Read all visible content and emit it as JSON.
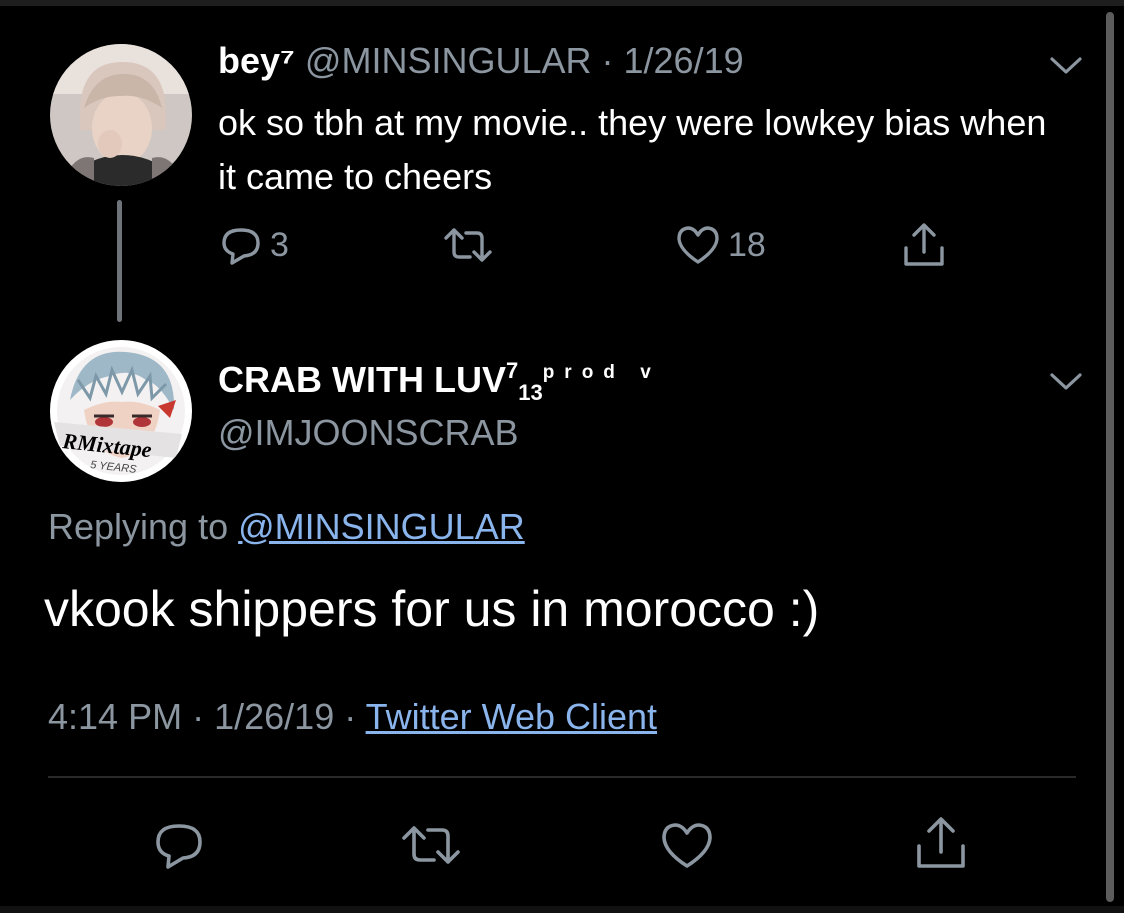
{
  "colors": {
    "background": "#000000",
    "text_primary": "#ffffff",
    "text_secondary": "#8b96a0",
    "link": "#8ab4ec",
    "thread_line": "#6e7479"
  },
  "parent_tweet": {
    "display_name": "bey⁷",
    "handle": "@MINSINGULAR",
    "separator": "·",
    "date": "1/26/19",
    "text": "ok so tbh at my movie.. they were lowkey bias when it came to cheers",
    "actions": {
      "reply_icon": "reply-icon",
      "reply_count": "3",
      "retweet_icon": "retweet-icon",
      "like_icon": "heart-icon",
      "like_count": "18",
      "share_icon": "share-icon"
    },
    "menu_icon": "chevron-down-icon"
  },
  "main_tweet": {
    "display_name": "CRAB WITH LUV",
    "name_sup": "7",
    "name_sub": "13",
    "name_prod": "prod v",
    "handle": "@IMJOONSCRAB",
    "avatar_text": "RMixtape",
    "avatar_subtext": "5 YEARS",
    "replying_label": "Replying to",
    "replying_to": "@MINSINGULAR",
    "text": "vkook shippers for us in morocco :)",
    "time": "4:14 PM",
    "separator": "·",
    "date": "1/26/19",
    "client": "Twitter Web Client",
    "menu_icon": "chevron-down-icon",
    "actions": {
      "reply_icon": "reply-icon",
      "retweet_icon": "retweet-icon",
      "like_icon": "heart-icon",
      "share_icon": "share-icon"
    }
  }
}
